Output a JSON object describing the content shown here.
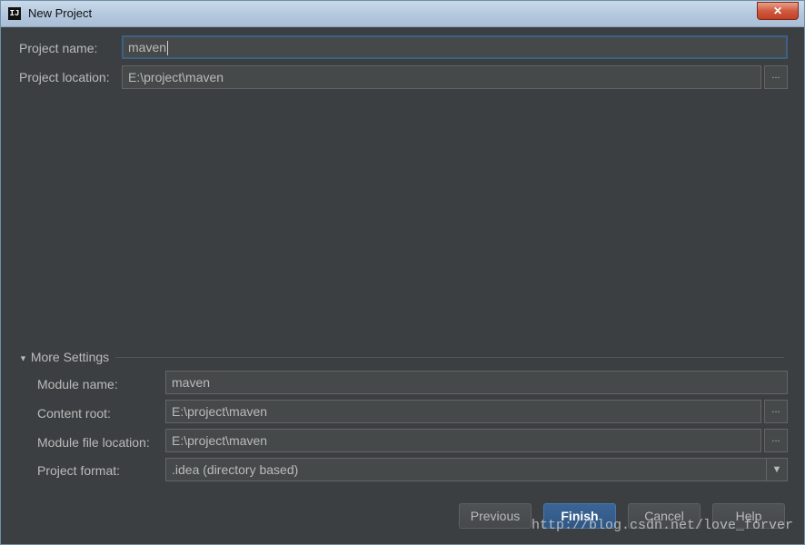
{
  "window": {
    "title": "New Project",
    "close_label": "✕"
  },
  "project": {
    "name_label": "Project name:",
    "name_value": "maven",
    "location_label": "Project location:",
    "location_value": "E:\\project\\maven"
  },
  "more_settings": {
    "header": "More Settings",
    "module_name_label": "Module name:",
    "module_name_value": "maven",
    "content_root_label": "Content root:",
    "content_root_value": "E:\\project\\maven",
    "module_file_location_label": "Module file location:",
    "module_file_location_value": "E:\\project\\maven",
    "project_format_label": "Project format:",
    "project_format_value": ".idea (directory based)"
  },
  "browse_label": "...",
  "buttons": {
    "previous": "Previous",
    "finish": "Finish",
    "cancel": "Cancel",
    "help": "Help"
  },
  "watermark": "http://blog.csdn.net/love_forver"
}
